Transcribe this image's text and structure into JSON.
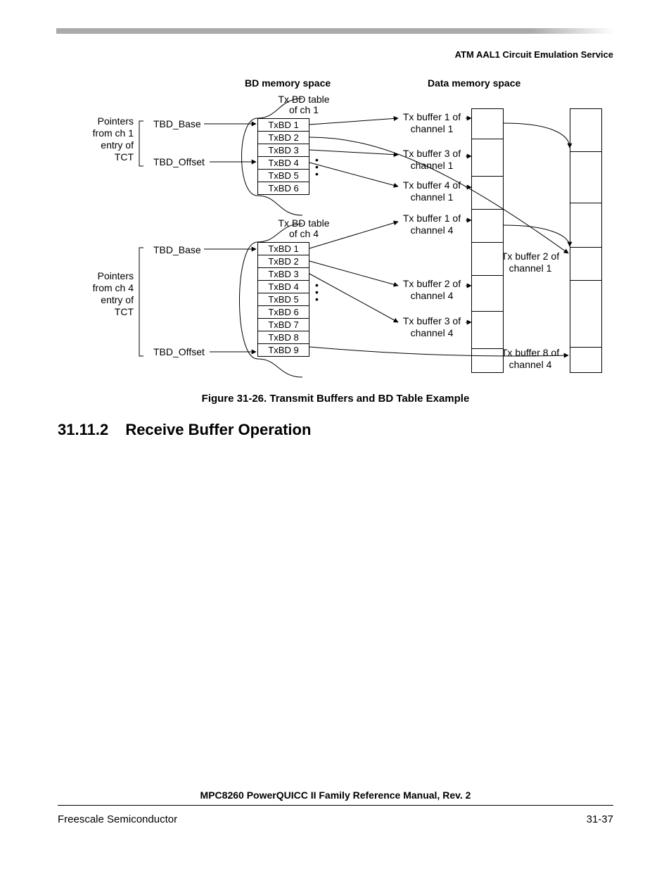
{
  "header": {
    "running": "ATM AAL1 Circuit Emulation Service"
  },
  "figure": {
    "col1": "BD memory space",
    "col2": "Data memory space",
    "ptr1_lines": [
      "Pointers",
      "from ch 1",
      "entry of",
      "TCT"
    ],
    "ptr4_lines": [
      "Pointers",
      "from ch 4",
      "entry of",
      "TCT"
    ],
    "tbd_base": "TBD_Base",
    "tbd_offset": "TBD_Offset",
    "bd_title1": [
      "Tx BD table",
      "of ch 1"
    ],
    "bd_title4": [
      "Tx BD table",
      "of ch 4"
    ],
    "bd_rows1": [
      "TxBD 1",
      "TxBD 2",
      "TxBD 3",
      "TxBD 4",
      "TxBD 5",
      "TxBD 6"
    ],
    "bd_rows4": [
      "TxBD 1",
      "TxBD 2",
      "TxBD 3",
      "TxBD 4",
      "TxBD 5",
      "TxBD 6",
      "TxBD 7",
      "TxBD 8",
      "TxBD 9"
    ],
    "buf": {
      "b1c1": [
        "Tx buffer 1 of",
        "channel 1"
      ],
      "b3c1": [
        "Tx buffer 3 of",
        "channel 1"
      ],
      "b4c1": [
        "Tx buffer 4 of",
        "channel 1"
      ],
      "b1c4": [
        "Tx buffer 1 of",
        "channel 4"
      ],
      "b2c1": [
        "Tx buffer 2 of",
        "channel 1"
      ],
      "b2c4": [
        "Tx buffer 2 of",
        "channel 4"
      ],
      "b3c4": [
        "Tx buffer 3 of",
        "channel 4"
      ],
      "b8c4": [
        "Tx buffer 8 of",
        "channel 4"
      ]
    },
    "caption": "Figure 31-26. Transmit Buffers and BD Table Example"
  },
  "section": {
    "num": "31.11.2",
    "title": "Receive Buffer Operation"
  },
  "footer": {
    "title": "MPC8260 PowerQUICC II Family Reference Manual, Rev. 2",
    "left": "Freescale Semiconductor",
    "right": "31-37"
  }
}
